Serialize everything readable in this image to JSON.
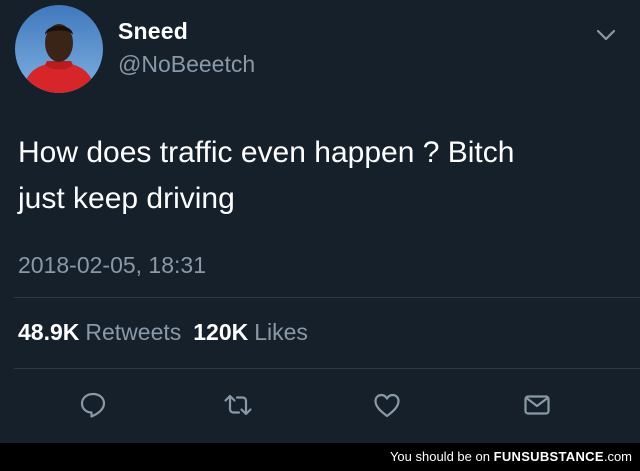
{
  "user": {
    "display_name": "Sneed",
    "handle": "@NoBeeetch"
  },
  "tweet": {
    "text": "How does traffic even happen ?  Bitch\njust keep driving",
    "timestamp": "2018-02-05, 18:31"
  },
  "stats": {
    "retweets_count": "48.9K",
    "retweets_label": "Retweets",
    "likes_count": "120K",
    "likes_label": "Likes"
  },
  "actions": [
    "reply-icon",
    "retweet-icon",
    "like-icon",
    "share-icon"
  ],
  "footer": {
    "watermark_prefix": "You should be on",
    "watermark_brand": "FUNSUBSTANCE",
    "watermark_suffix": ".com"
  },
  "colors": {
    "background": "#15202b",
    "text": "#ffffff",
    "secondary_text": "#8a99a7",
    "divider": "#2f3b47",
    "avatar_sky": "#4a86c8",
    "avatar_shirt": "#d6262a"
  }
}
